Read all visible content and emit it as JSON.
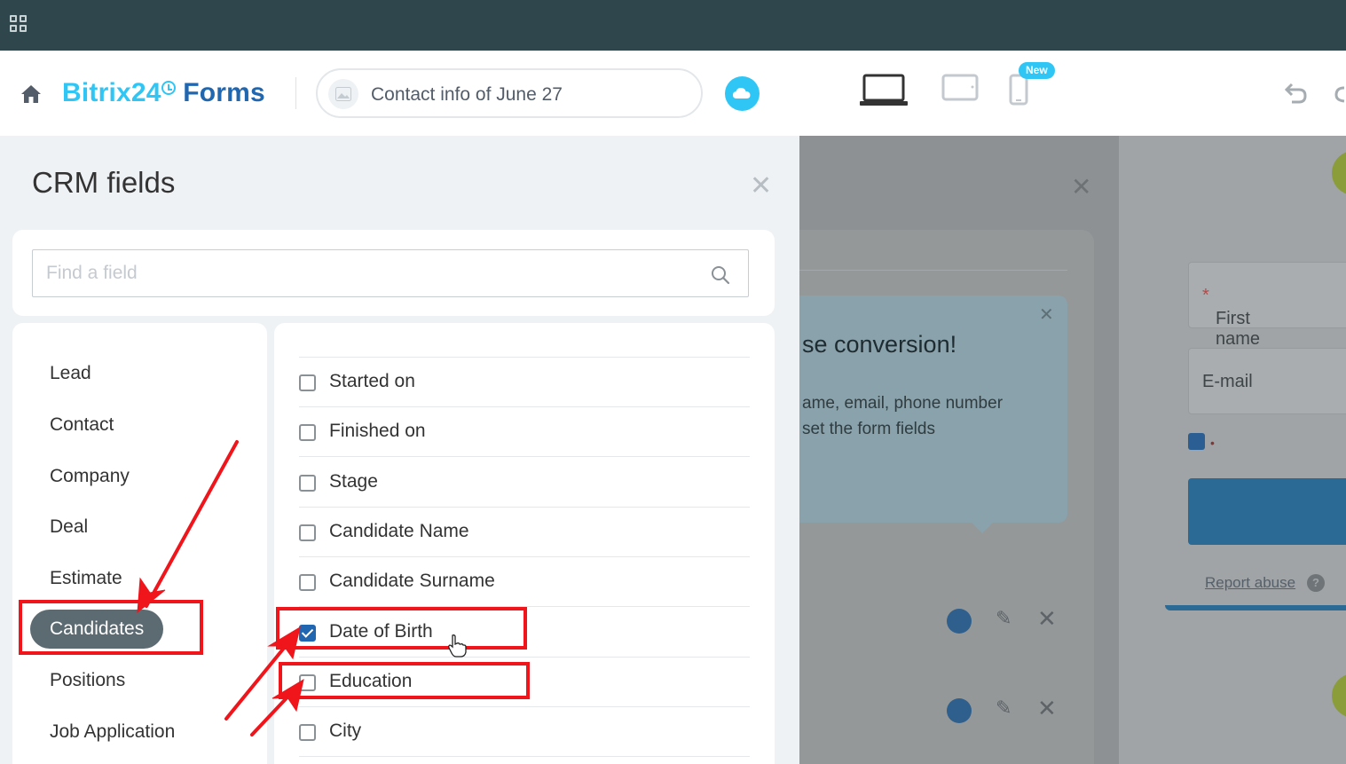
{
  "header": {
    "brand_part1": "Bitrix24",
    "brand_part2": " Forms",
    "form_title": "Contact info of June 27",
    "new_badge": "New"
  },
  "panel": {
    "title": "CRM fields",
    "search_placeholder": "Find a field",
    "categories": [
      {
        "label": "Lead",
        "active": false
      },
      {
        "label": "Contact",
        "active": false
      },
      {
        "label": "Company",
        "active": false
      },
      {
        "label": "Deal",
        "active": false
      },
      {
        "label": "Estimate",
        "active": false
      },
      {
        "label": "Candidates",
        "active": true
      },
      {
        "label": "Positions",
        "active": false
      },
      {
        "label": "Job Application",
        "active": false
      }
    ],
    "fields": [
      {
        "label": "Started on",
        "checked": false
      },
      {
        "label": "Finished on",
        "checked": false
      },
      {
        "label": "Stage",
        "checked": false
      },
      {
        "label": "Candidate Name",
        "checked": false
      },
      {
        "label": "Candidate Surname",
        "checked": false
      },
      {
        "label": "Date of Birth",
        "checked": true
      },
      {
        "label": "Education",
        "checked": false
      },
      {
        "label": "City",
        "checked": false
      }
    ]
  },
  "editor": {
    "tip_title": "se conversion!",
    "tip_line1": "ame, email, phone number",
    "tip_line2": "set the form fields"
  },
  "preview": {
    "first_name": "First name",
    "required_mark": "*",
    "email": "E-mail",
    "consent_mark": "•",
    "report_abuse": "Report abuse",
    "help": "?"
  },
  "colors": {
    "topbar": "#2f464d",
    "brand_light": "#2fc6f6",
    "brand_dark": "#2067b0",
    "active_category": "#5c6a72",
    "checkbox_checked": "#2066b0",
    "annotation": "#f0141b"
  },
  "icons": {
    "apps": "apps-grid-icon",
    "home": "home-icon",
    "cloud": "cloud-icon",
    "search": "search-icon",
    "close": "close-icon",
    "laptop": "laptop-icon",
    "tablet": "tablet-icon",
    "phone": "phone-icon",
    "undo": "undo-icon",
    "redo": "redo-icon"
  }
}
